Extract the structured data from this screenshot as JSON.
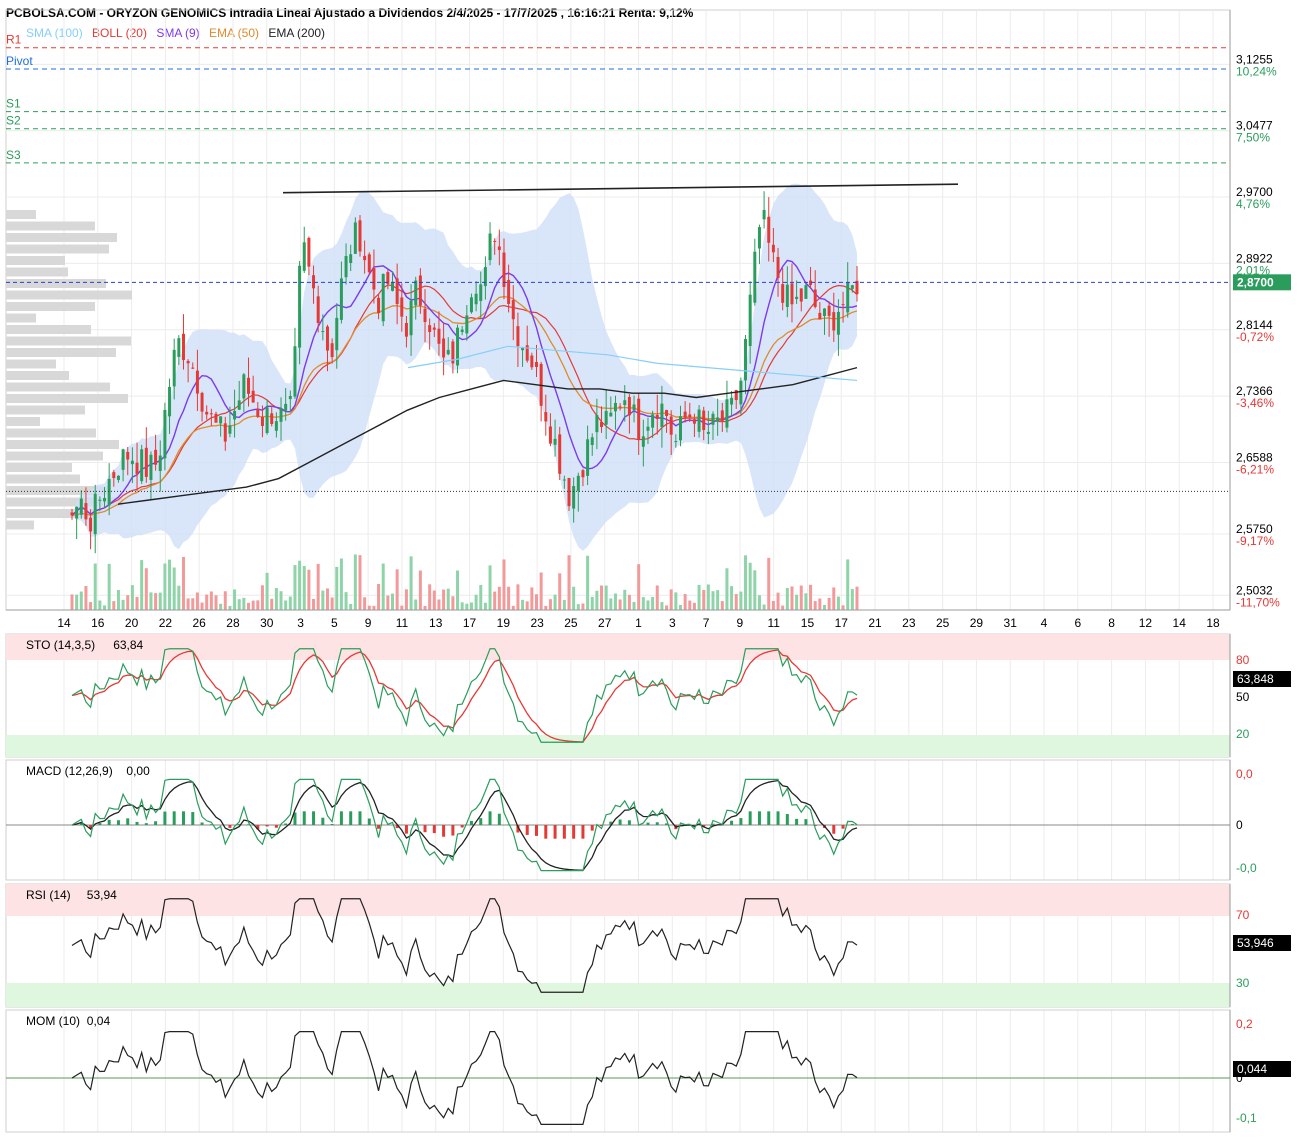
{
  "title": "PCBOLSA.COM - ORYZON GENOMICS Intradia Lineal Ajustado a Dividendos 2/4/2025 - 17/7/2025 , 16:16:21 Renta: 9,12%",
  "legend": [
    {
      "label": "SMA (100)",
      "color": "#87cefa"
    },
    {
      "label": "BOLL (20)",
      "color": "#e53935"
    },
    {
      "label": "SMA (9)",
      "color": "#7c3aed"
    },
    {
      "label": "EMA (50)",
      "color": "#e08a2c"
    },
    {
      "label": "EMA (200)",
      "color": "#222222"
    }
  ],
  "pivots": [
    {
      "label": "R1",
      "value": 3.145,
      "color": "#e53935"
    },
    {
      "label": "Pivot",
      "value": 3.12,
      "color": "#1e6fd9"
    },
    {
      "label": "S1",
      "value": 3.07,
      "color": "#2a9d5c"
    },
    {
      "label": "S2",
      "value": 3.05,
      "color": "#2a9d5c"
    },
    {
      "label": "S3",
      "value": 3.01,
      "color": "#2a9d5c"
    }
  ],
  "price_axis": [
    {
      "price": "3,1255",
      "pct": "10,24%",
      "color": "#2a9d5c"
    },
    {
      "price": "3,0477",
      "pct": "7,50%",
      "color": "#2a9d5c"
    },
    {
      "price": "2,9700",
      "pct": "4,76%",
      "color": "#2a9d5c"
    },
    {
      "price": "2,8922",
      "pct": "2,01%",
      "color": "#2a9d5c"
    },
    {
      "price": "2,8144",
      "pct": "-0,72%",
      "color": "#e53935"
    },
    {
      "price": "2,7366",
      "pct": "-3,46%",
      "color": "#e53935"
    },
    {
      "price": "2,6588",
      "pct": "-6,21%",
      "color": "#e53935"
    },
    {
      "price": "2,5750",
      "pct": "-9,17%",
      "color": "#e53935"
    },
    {
      "price": "2,5032",
      "pct": "-11,70%",
      "color": "#e53935"
    }
  ],
  "last_price": "2,8700",
  "last_price_value": 2.87,
  "accent_green": "#2a9d5c",
  "accent_red": "#e53935",
  "x_labels": [
    "14",
    "16",
    "20",
    "22",
    "26",
    "28",
    "30",
    "3",
    "5",
    "9",
    "11",
    "13",
    "17",
    "19",
    "23",
    "25",
    "27",
    "1",
    "3",
    "7",
    "9",
    "11",
    "15",
    "17",
    "21",
    "23",
    "25",
    "29",
    "31",
    "4",
    "6",
    "8",
    "12",
    "14",
    "18"
  ],
  "panels": {
    "sto": {
      "label": "STO (14,3,5)",
      "value": "63,84",
      "levels": [
        "80",
        "50",
        "20"
      ],
      "badge": "63,848"
    },
    "macd": {
      "label": "MACD (12,26,9)",
      "value": "0,00",
      "levels": [
        "0,0",
        "0",
        "-0,0"
      ]
    },
    "rsi": {
      "label": "RSI (14)",
      "value": "53,94",
      "levels": [
        "70",
        "30"
      ],
      "badge": "53,946"
    },
    "mom": {
      "label": "MOM (10)",
      "value": "0,04",
      "levels": [
        "0,2",
        "0",
        "-0,1"
      ],
      "badge": "0,044"
    }
  },
  "chart_data": {
    "type": "candlestick",
    "period": "2/4/2025 - 17/7/2025",
    "close_path": [
      2.6,
      2.61,
      2.59,
      2.62,
      2.64,
      2.66,
      2.67,
      2.66,
      2.65,
      2.66,
      2.74,
      2.8,
      2.79,
      2.76,
      2.72,
      2.7,
      2.69,
      2.72,
      2.75,
      2.73,
      2.71,
      2.72,
      2.71,
      2.72,
      2.92,
      2.87,
      2.83,
      2.78,
      2.86,
      2.91,
      2.93,
      2.88,
      2.85,
      2.87,
      2.84,
      2.82,
      2.86,
      2.84,
      2.8,
      2.77,
      2.79,
      2.84,
      2.88,
      2.86,
      2.94,
      2.89,
      2.83,
      2.8,
      2.78,
      2.74,
      2.7,
      2.66,
      2.62,
      2.65,
      2.68,
      2.71,
      2.7,
      2.73,
      2.74,
      2.7,
      2.71,
      2.73,
      2.72,
      2.68,
      2.71,
      2.72,
      2.69,
      2.7,
      2.71,
      2.72,
      2.76,
      2.86,
      2.95,
      2.9,
      2.87,
      2.84,
      2.85,
      2.86,
      2.83,
      2.82,
      2.84,
      2.85,
      2.87
    ],
    "ema200_path": [
      2.61,
      2.615,
      2.62,
      2.625,
      2.63,
      2.64,
      2.66,
      2.68,
      2.7,
      2.72,
      2.735,
      2.745,
      2.755,
      2.75,
      2.745,
      2.745,
      2.74,
      2.74,
      2.735,
      2.74,
      2.745,
      2.75,
      2.76,
      2.77
    ],
    "sma100_path": [
      2.77,
      2.78,
      2.795,
      2.79,
      2.785,
      2.775,
      2.77,
      2.765,
      2.76,
      2.755
    ],
    "trendline": {
      "from": 2.975,
      "to": 2.985
    },
    "support_line": 2.625
  }
}
